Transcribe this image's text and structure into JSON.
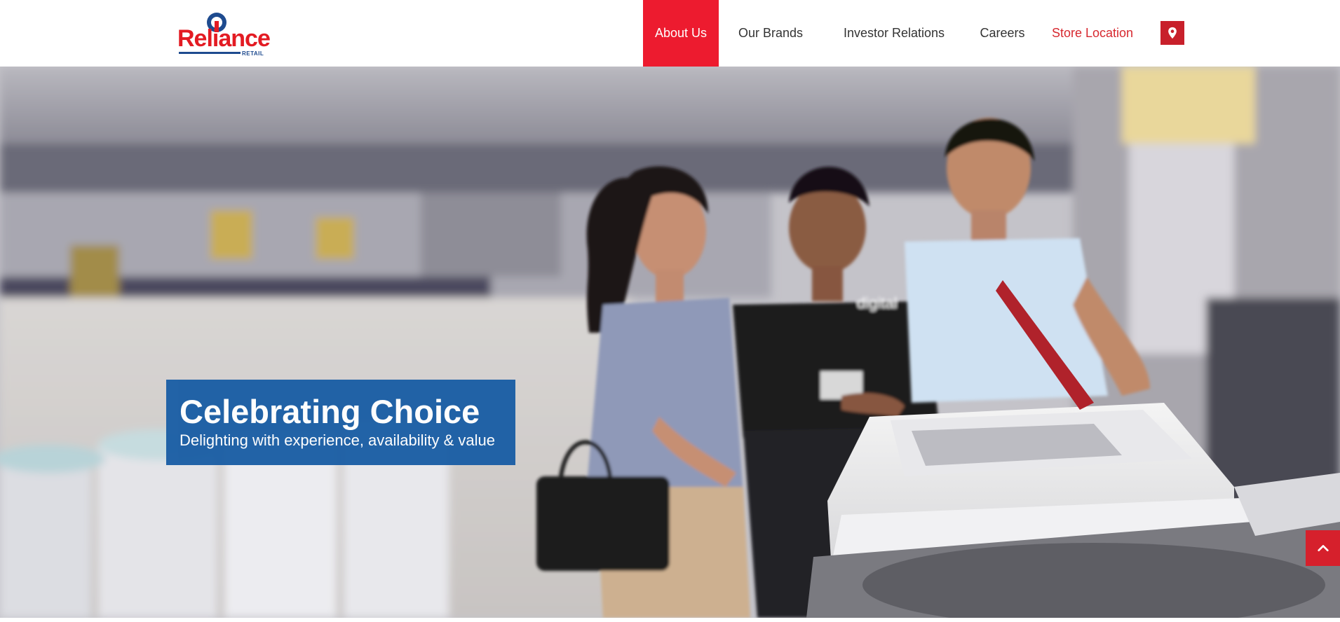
{
  "brand": {
    "logo_word": "Reliance",
    "logo_sub": "RETAIL",
    "logo_red": "#e31b23",
    "logo_blue": "#1e4b8f"
  },
  "nav": {
    "items": [
      {
        "label": "About Us",
        "active": true
      },
      {
        "label": "Our Brands"
      },
      {
        "label": "Investor Relations"
      },
      {
        "label": "Careers"
      },
      {
        "label": "Store Location",
        "highlight": true
      }
    ],
    "location_icon": "map-pin-icon",
    "active_color": "#ed1b2f"
  },
  "hero": {
    "title": "Celebrating Choice",
    "subtitle": "Delighting with experience, availability & value",
    "caption_color": "#1c5fa5",
    "staff_shirt_logo": "digital"
  },
  "back_to_top": {
    "icon": "chevron-up-icon",
    "color": "#d6202c"
  }
}
